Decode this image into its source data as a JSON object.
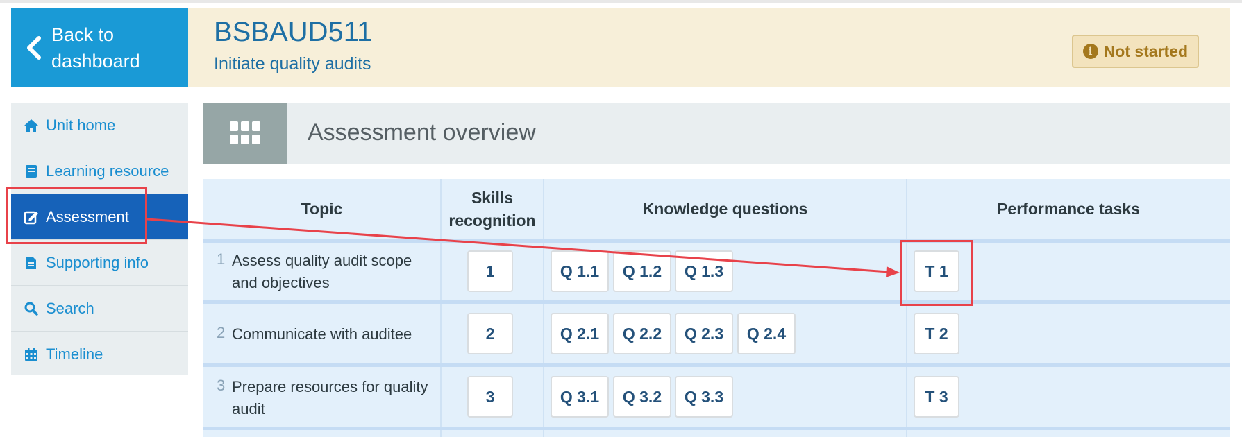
{
  "back_button": {
    "label_line1": "Back to",
    "label_line2": "dashboard"
  },
  "unit": {
    "code": "BSBAUD511",
    "title": "Initiate quality audits"
  },
  "status": {
    "label": "Not started",
    "icon": "info-circle-icon",
    "color": "#a4781d"
  },
  "sidebar": {
    "items": [
      {
        "label": "Unit home",
        "icon": "home-icon",
        "active": false
      },
      {
        "label": "Learning resource",
        "icon": "book-icon",
        "active": false
      },
      {
        "label": "Assessment",
        "icon": "edit-icon",
        "active": true
      },
      {
        "label": "Supporting info",
        "icon": "document-icon",
        "active": false
      },
      {
        "label": "Search",
        "icon": "search-icon",
        "active": false
      },
      {
        "label": "Timeline",
        "icon": "calendar-icon",
        "active": false
      }
    ]
  },
  "overview": {
    "title": "Assessment overview",
    "icon": "grid-icon"
  },
  "table": {
    "headers": {
      "topic": "Topic",
      "skills_line1": "Skills",
      "skills_line2": "recognition",
      "knowledge": "Knowledge questions",
      "performance": "Performance tasks"
    },
    "rows": [
      {
        "num": "1",
        "topic_line1": "Assess quality audit scope",
        "topic_line2": "and objectives",
        "skill": "1",
        "questions": [
          "Q 1.1",
          "Q 1.2",
          "Q 1.3"
        ],
        "task": "T 1"
      },
      {
        "num": "2",
        "topic_line1": "Communicate with auditee",
        "topic_line2": "",
        "skill": "2",
        "questions": [
          "Q 2.1",
          "Q 2.2",
          "Q 2.3",
          "Q 2.4"
        ],
        "task": "T 2"
      },
      {
        "num": "3",
        "topic_line1": "Prepare resources for quality",
        "topic_line2": "audit",
        "skill": "3",
        "questions": [
          "Q 3.1",
          "Q 3.2",
          "Q 3.3"
        ],
        "task": "T 3"
      }
    ]
  },
  "colors": {
    "accent": "#1a9ad6",
    "active_nav": "#1662b9",
    "annotation": "#e8424a"
  }
}
